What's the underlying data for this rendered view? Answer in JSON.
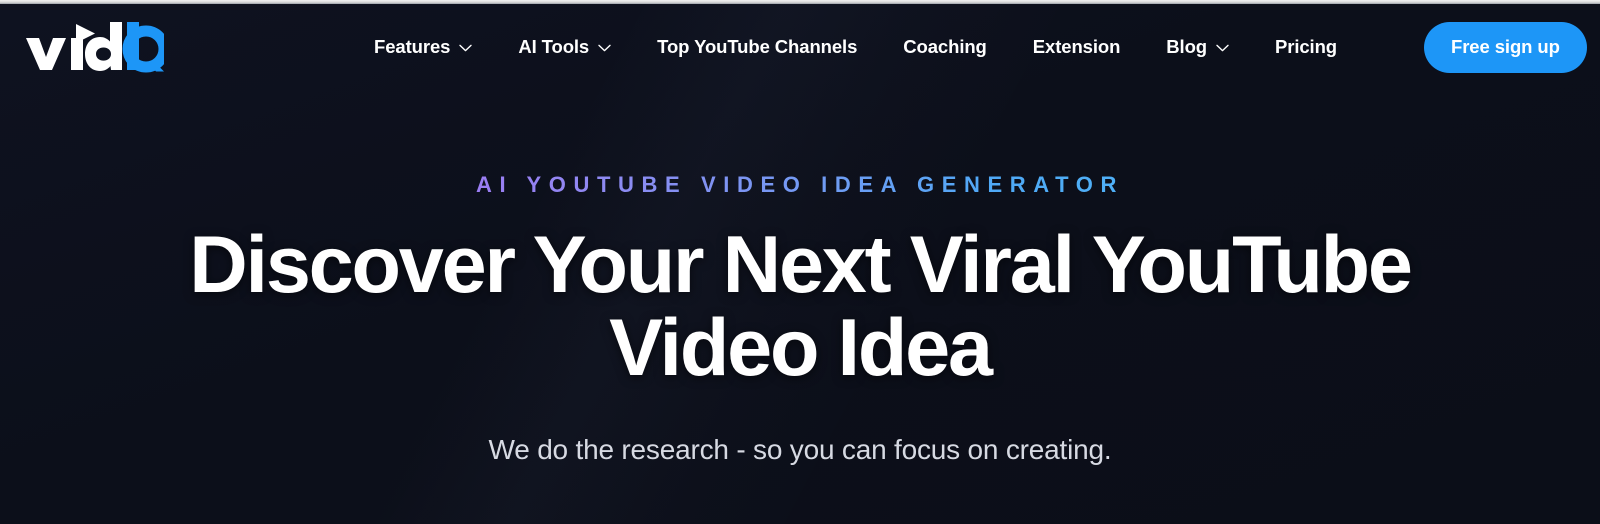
{
  "site": {
    "brand_name": "vidIQ",
    "brand_part_light": "vid",
    "brand_part_accent": "IQ",
    "accent_color": "#1d96f7",
    "background_color": "#0d1018"
  },
  "nav": {
    "items": [
      {
        "label": "Features",
        "has_dropdown": true,
        "icon": "chevron-down-icon"
      },
      {
        "label": "AI Tools",
        "has_dropdown": true,
        "icon": "chevron-down-icon"
      },
      {
        "label": "Top YouTube Channels",
        "has_dropdown": false,
        "icon": ""
      },
      {
        "label": "Coaching",
        "has_dropdown": false,
        "icon": ""
      },
      {
        "label": "Extension",
        "has_dropdown": false,
        "icon": ""
      },
      {
        "label": "Blog",
        "has_dropdown": true,
        "icon": "chevron-down-icon"
      },
      {
        "label": "Pricing",
        "has_dropdown": false,
        "icon": ""
      }
    ],
    "cta_label": "Free sign up"
  },
  "hero": {
    "eyebrow": "AI YouTube Video Idea Generator",
    "headline": "Discover Your Next Viral YouTube Video Idea",
    "headline_line_1": "Discover Your Next Viral YouTube",
    "headline_line_2": "Video Idea",
    "subtitle": "We do the research - so you can focus on creating.",
    "eyebrow_gradient_start": "#9b7df3",
    "eyebrow_gradient_end": "#4fb0f7"
  }
}
